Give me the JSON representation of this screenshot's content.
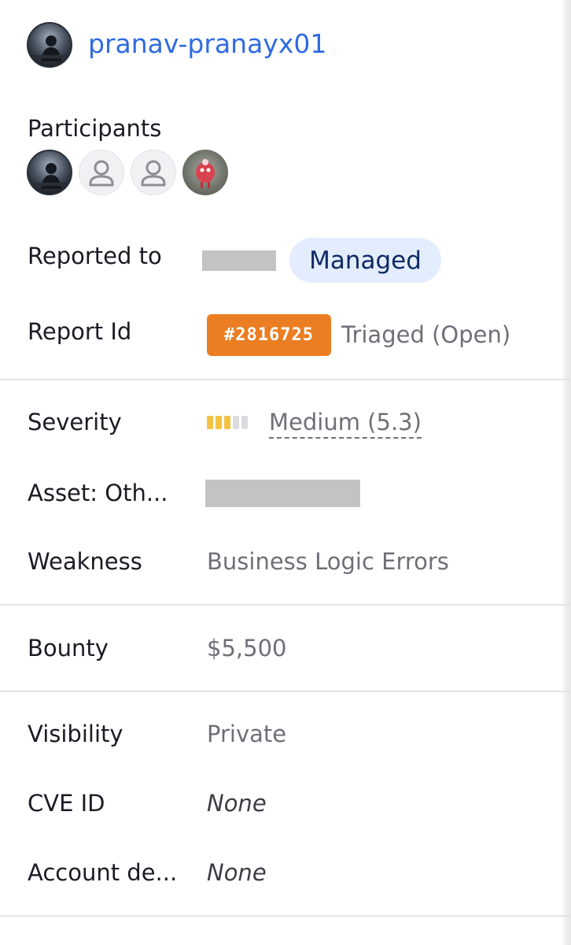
{
  "reporter": {
    "username": "pranav-pranayx01",
    "avatar_icon": "user-photo-avatar"
  },
  "participants": {
    "label": "Participants",
    "avatars": [
      {
        "kind": "photo",
        "icon": "user-photo-avatar"
      },
      {
        "kind": "placeholder",
        "icon": "person-placeholder-icon"
      },
      {
        "kind": "placeholder",
        "icon": "person-placeholder-icon"
      },
      {
        "kind": "photo",
        "icon": "mascot-avatar"
      }
    ]
  },
  "reported_to": {
    "label": "Reported to",
    "program_badge": "Managed"
  },
  "report_id": {
    "label": "Report Id",
    "id": "#2816725",
    "status": "Triaged (Open)"
  },
  "severity": {
    "label": "Severity",
    "value": "Medium (5.3)",
    "level_filled": 3,
    "level_total": 5
  },
  "asset": {
    "label": "Asset: Oth..."
  },
  "weakness": {
    "label": "Weakness",
    "value": "Business Logic Errors"
  },
  "bounty": {
    "label": "Bounty",
    "value": "$5,500"
  },
  "visibility": {
    "label": "Visibility",
    "value": "Private"
  },
  "cve": {
    "label": "CVE ID",
    "value": "None"
  },
  "account": {
    "label": "Account de...",
    "value": "None"
  },
  "colors": {
    "link": "#2f6be0",
    "report_id_badge": "#eb7e22",
    "managed_pill_bg": "#e3edfd",
    "severity_medium": "#f5c242"
  }
}
